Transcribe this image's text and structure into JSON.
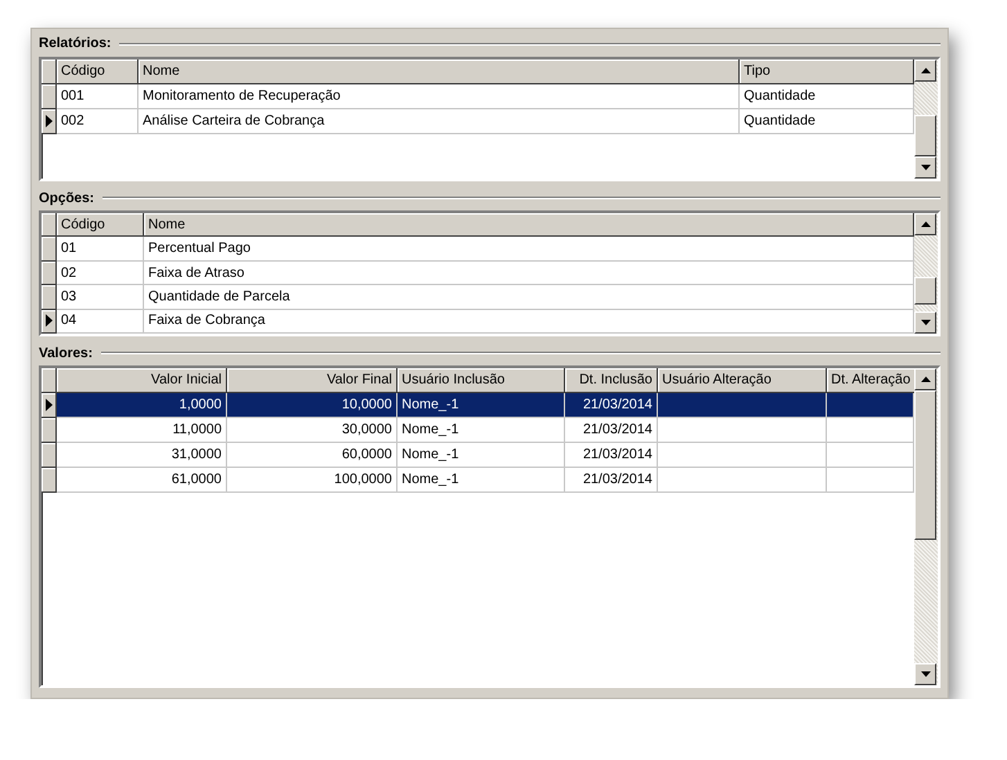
{
  "sections": [
    {
      "title": "Relatórios:",
      "focused": false,
      "columns": [
        "Código",
        "Nome",
        "Tipo"
      ],
      "rows": [
        {
          "cells": [
            "001",
            "Monitoramento de Recuperação",
            "Quantidade"
          ],
          "selected": false
        },
        {
          "cells": [
            "002",
            "Análise Carteira de Cobrança",
            "Quantidade"
          ],
          "selected": true
        }
      ]
    },
    {
      "title": "Opções:",
      "focused": false,
      "columns": [
        "Código",
        "Nome"
      ],
      "rows": [
        {
          "cells": [
            "01",
            "Percentual Pago"
          ],
          "selected": false
        },
        {
          "cells": [
            "02",
            "Faixa de Atraso"
          ],
          "selected": false
        },
        {
          "cells": [
            "03",
            "Quantidade de Parcela"
          ],
          "selected": false
        },
        {
          "cells": [
            "04",
            "Faixa de Cobrança"
          ],
          "selected": true
        }
      ]
    },
    {
      "title": "Valores:",
      "focused": true,
      "columns": [
        "Valor Inicial",
        "Valor Final",
        "Usuário Inclusão",
        "Dt. Inclusão",
        "Usuário Alteração",
        "Dt. Alteração"
      ],
      "rows": [
        {
          "cells": [
            "1,0000",
            "10,0000",
            "Nome_-1",
            "21/03/2014"
          ],
          "selected": true
        },
        {
          "cells": [
            "11,0000",
            "30,0000",
            "Nome_-1",
            "21/03/2014"
          ],
          "selected": false
        },
        {
          "cells": [
            "31,0000",
            "60,0000",
            "Nome_-1",
            "21/03/2014"
          ],
          "selected": false
        },
        {
          "cells": [
            "61,0000",
            "100,0000",
            "Nome_-1",
            "21/03/2014"
          ],
          "selected": false
        }
      ]
    }
  ]
}
